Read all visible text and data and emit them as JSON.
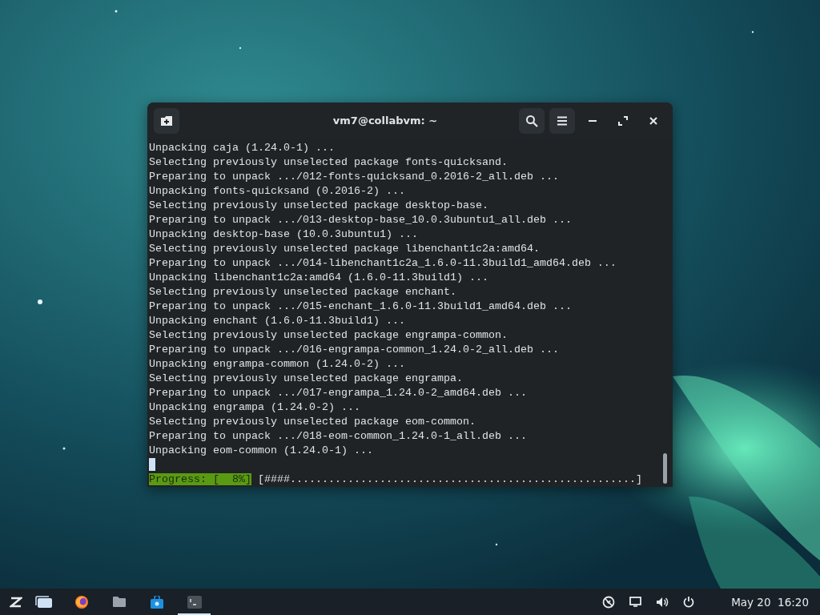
{
  "window": {
    "title": "vm7@collabvm: ~"
  },
  "terminal": {
    "lines": [
      "Unpacking caja (1.24.0-1) ...",
      "Selecting previously unselected package fonts-quicksand.",
      "Preparing to unpack .../012-fonts-quicksand_0.2016-2_all.deb ...",
      "Unpacking fonts-quicksand (0.2016-2) ...",
      "Selecting previously unselected package desktop-base.",
      "Preparing to unpack .../013-desktop-base_10.0.3ubuntu1_all.deb ...",
      "Unpacking desktop-base (10.0.3ubuntu1) ...",
      "Selecting previously unselected package libenchant1c2a:amd64.",
      "Preparing to unpack .../014-libenchant1c2a_1.6.0-11.3build1_amd64.deb ...",
      "Unpacking libenchant1c2a:amd64 (1.6.0-11.3build1) ...",
      "Selecting previously unselected package enchant.",
      "Preparing to unpack .../015-enchant_1.6.0-11.3build1_amd64.deb ...",
      "Unpacking enchant (1.6.0-11.3build1) ...",
      "Selecting previously unselected package engrampa-common.",
      "Preparing to unpack .../016-engrampa-common_1.24.0-2_all.deb ...",
      "Unpacking engrampa-common (1.24.0-2) ...",
      "Selecting previously unselected package engrampa.",
      "Preparing to unpack .../017-engrampa_1.24.0-2_amd64.deb ...",
      "Unpacking engrampa (1.24.0-2) ...",
      "Selecting previously unselected package eom-common.",
      "Preparing to unpack .../018-eom-common_1.24.0-1_all.deb ...",
      "Unpacking eom-common (1.24.0-1) ..."
    ],
    "progress_label": "Progress: [  8%]",
    "progress_bar": "[####......................................................]"
  },
  "taskbar": {
    "apps": [
      {
        "kind": "windows",
        "selected": false
      },
      {
        "kind": "browser",
        "selected": false
      },
      {
        "kind": "folder",
        "selected": false
      },
      {
        "kind": "store",
        "selected": false
      },
      {
        "kind": "terminal",
        "selected": true
      }
    ],
    "clock": "May 20  16:20"
  }
}
